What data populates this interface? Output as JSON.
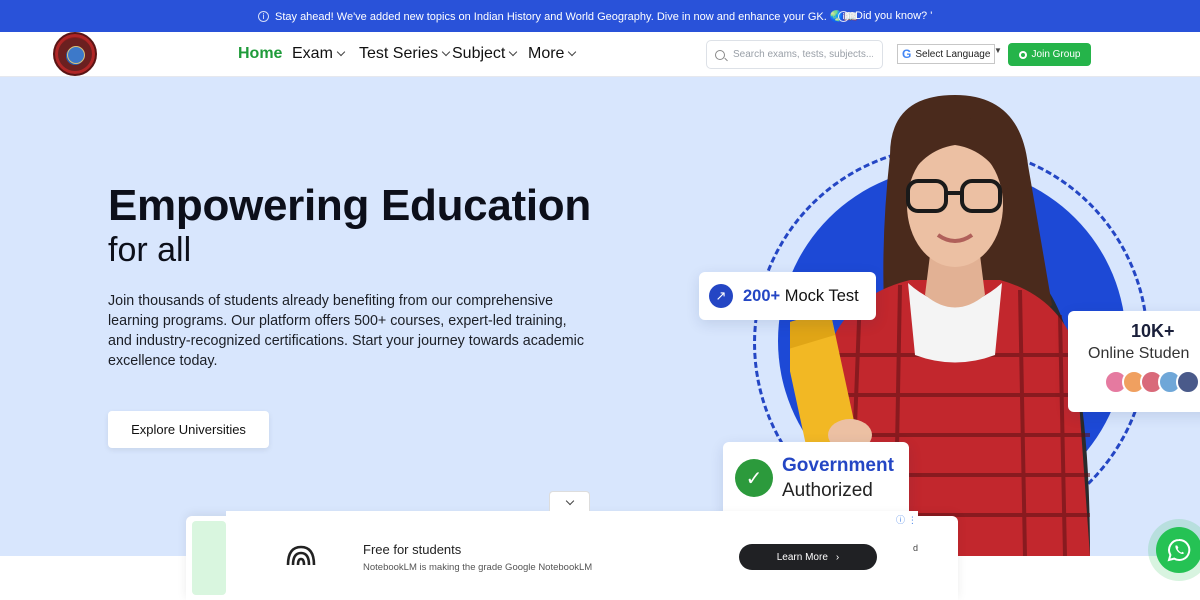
{
  "announcement": {
    "message": "Stay ahead! We've added new topics on Indian History and World Geography. Dive in now and enhance your GK. 🌏📖",
    "message2": "Did you know? '"
  },
  "nav": {
    "items": [
      {
        "label": "Home",
        "active": true
      },
      {
        "label": "Exam"
      },
      {
        "label": "Test Series"
      },
      {
        "label": "Subject"
      },
      {
        "label": "More"
      }
    ]
  },
  "search": {
    "placeholder": "Search exams, tests, subjects..."
  },
  "language": {
    "label": "Select Language",
    "icon": "G",
    "arrow": "▼"
  },
  "join_button": {
    "label": "Join Group"
  },
  "hero": {
    "title": "Empowering Education",
    "subtitle": "for all",
    "description": "Join thousands of students already benefiting from our comprehensive learning programs. Our platform offers 500+ courses, expert-led training, and industry-recognized certifications. Start your journey towards academic excellence today.",
    "cta": "Explore Universities"
  },
  "badges": {
    "mock": {
      "number": "200+",
      "text": " Mock Test",
      "icon": "arrow-up-right-icon"
    },
    "online": {
      "number": "10K+",
      "text": "Online Studen"
    },
    "gov": {
      "line1": "Government",
      "line2": "Authorized"
    }
  },
  "ad": {
    "title": "Free for students",
    "subtitle": "NotebookLM is making the grade Google NotebookLM",
    "button": "Learn More",
    "button_icon": "›",
    "info_icon": "ⓘ ⋮",
    "truncated_char": "d"
  },
  "colors": {
    "primary": "#2952d9",
    "accent_green": "#25b44a",
    "hero_bg": "#d8e6fd"
  }
}
